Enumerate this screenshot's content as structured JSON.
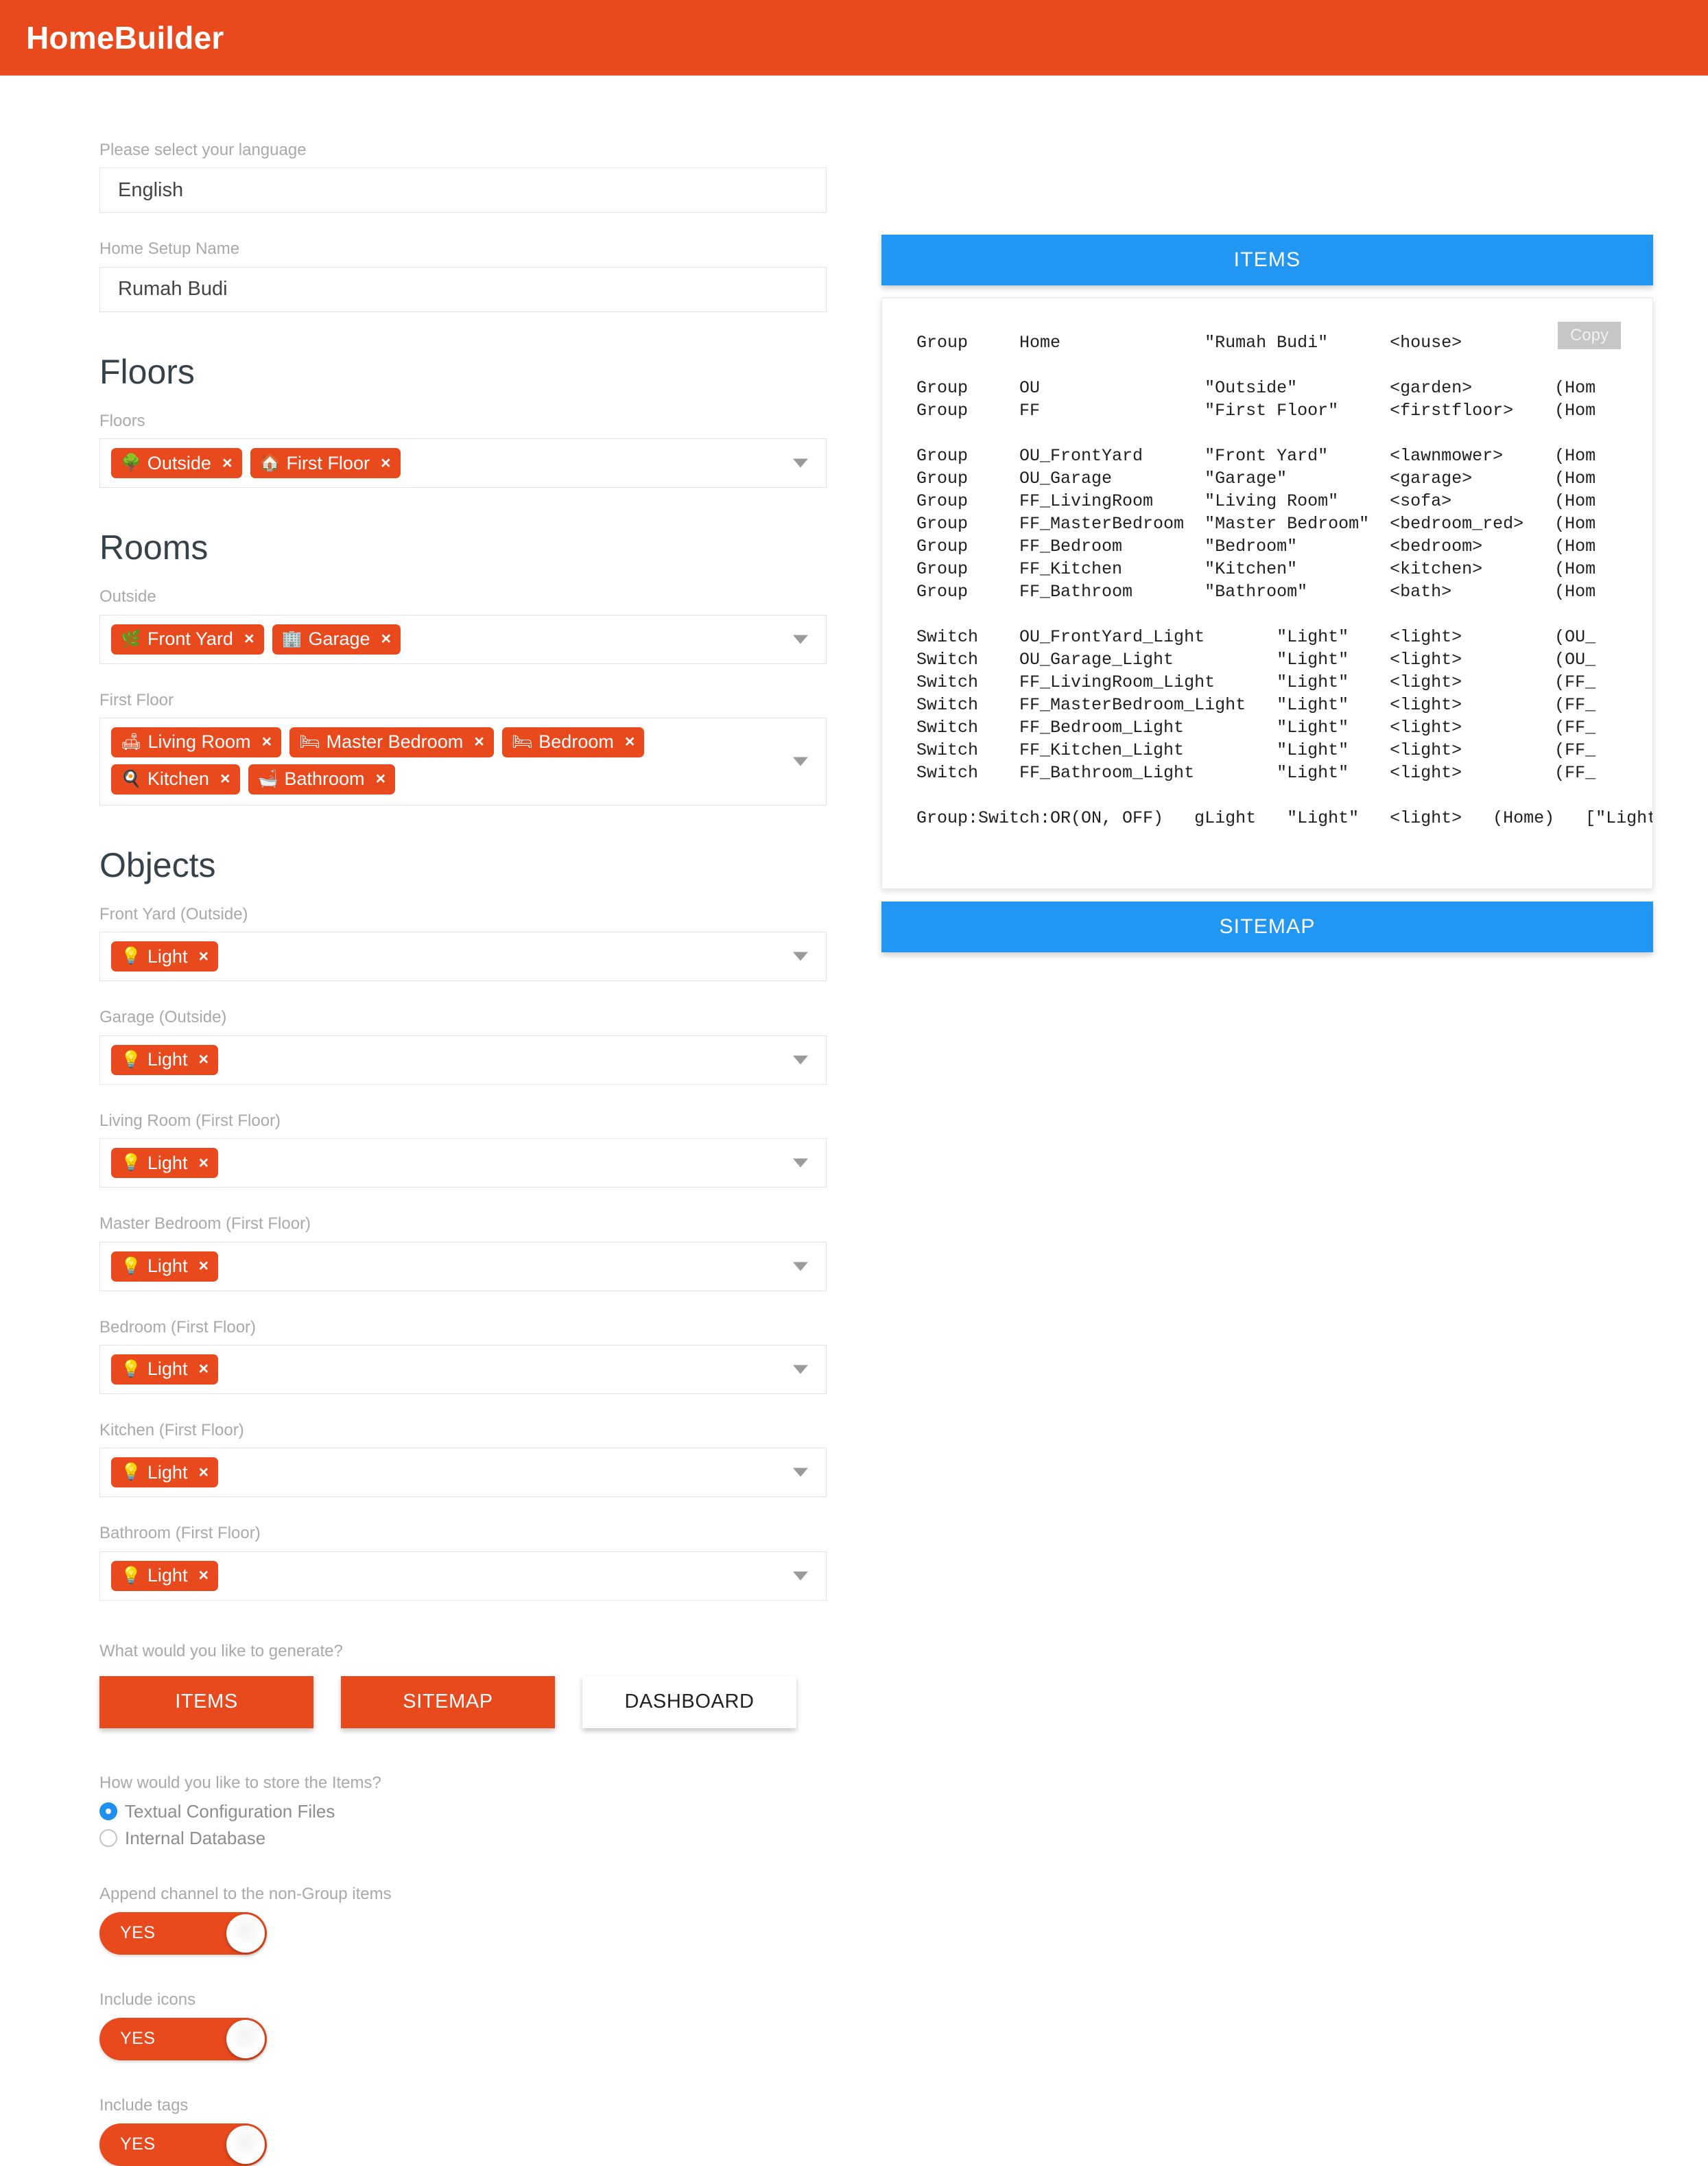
{
  "app": {
    "title": "HomeBuilder",
    "accent_color": "#e8491d",
    "panel_color": "#2196f3",
    "heading_color": "#35424a"
  },
  "form": {
    "language": {
      "label": "Please select your language",
      "value": "English"
    },
    "setup_name": {
      "label": "Home Setup Name",
      "value": "Rumah Budi"
    }
  },
  "floors": {
    "heading": "Floors",
    "field_label": "Floors",
    "chips": [
      {
        "emoji": "🌳",
        "icon_name": "tree-emoji",
        "label": "Outside",
        "remove": "×"
      },
      {
        "emoji": "🏠",
        "icon_name": "house-emoji",
        "label": "First Floor",
        "remove": "×"
      }
    ]
  },
  "rooms": {
    "heading": "Rooms",
    "groups": [
      {
        "label": "Outside",
        "chips": [
          {
            "emoji": "🌿",
            "icon_name": "herb-emoji",
            "label": "Front Yard",
            "remove": "×"
          },
          {
            "emoji": "🏢",
            "icon_name": "building-emoji",
            "label": "Garage",
            "remove": "×"
          }
        ]
      },
      {
        "label": "First Floor",
        "chips": [
          {
            "emoji": "🛋",
            "icon_name": "couch-emoji",
            "label": "Living Room",
            "remove": "×"
          },
          {
            "emoji": "🛏",
            "icon_name": "bed-emoji",
            "label": "Master Bedroom",
            "remove": "×"
          },
          {
            "emoji": "🛏",
            "icon_name": "bed-emoji",
            "label": "Bedroom",
            "remove": "×"
          },
          {
            "emoji": "🍳",
            "icon_name": "stove-emoji",
            "label": "Kitchen",
            "remove": "×"
          },
          {
            "emoji": "🛁",
            "icon_name": "bathtub-emoji",
            "label": "Bathroom",
            "remove": "×"
          }
        ]
      }
    ]
  },
  "objects": {
    "heading": "Objects",
    "groups": [
      {
        "label": "Front Yard (Outside)",
        "chips": [
          {
            "emoji": "💡",
            "icon_name": "bulb-emoji",
            "label": "Light",
            "remove": "×"
          }
        ]
      },
      {
        "label": "Garage (Outside)",
        "chips": [
          {
            "emoji": "💡",
            "icon_name": "bulb-emoji",
            "label": "Light",
            "remove": "×"
          }
        ]
      },
      {
        "label": "Living Room (First Floor)",
        "chips": [
          {
            "emoji": "💡",
            "icon_name": "bulb-emoji",
            "label": "Light",
            "remove": "×"
          }
        ]
      },
      {
        "label": "Master Bedroom (First Floor)",
        "chips": [
          {
            "emoji": "💡",
            "icon_name": "bulb-emoji",
            "label": "Light",
            "remove": "×"
          }
        ]
      },
      {
        "label": "Bedroom (First Floor)",
        "chips": [
          {
            "emoji": "💡",
            "icon_name": "bulb-emoji",
            "label": "Light",
            "remove": "×"
          }
        ]
      },
      {
        "label": "Kitchen (First Floor)",
        "chips": [
          {
            "emoji": "💡",
            "icon_name": "bulb-emoji",
            "label": "Light",
            "remove": "×"
          }
        ]
      },
      {
        "label": "Bathroom (First Floor)",
        "chips": [
          {
            "emoji": "💡",
            "icon_name": "bulb-emoji",
            "label": "Light",
            "remove": "×"
          }
        ]
      }
    ]
  },
  "generate": {
    "label": "What would you like to generate?",
    "buttons": [
      {
        "label": "ITEMS",
        "style": "primary"
      },
      {
        "label": "SITEMAP",
        "style": "primary"
      },
      {
        "label": "DASHBOARD",
        "style": "outline"
      }
    ]
  },
  "storage": {
    "label": "How would you like to store the Items?",
    "options": [
      {
        "label": "Textual Configuration Files",
        "checked": true
      },
      {
        "label": "Internal Database",
        "checked": false
      }
    ]
  },
  "toggles": [
    {
      "label": "Append channel to the non-Group items",
      "value": "YES"
    },
    {
      "label": "Include icons",
      "value": "YES"
    },
    {
      "label": "Include tags",
      "value": "YES"
    }
  ],
  "right_panel": {
    "items_button": "ITEMS",
    "sitemap_button": "SITEMAP",
    "copy_button": "Copy",
    "code": "Group     Home              \"Rumah Budi\"      <house>\n\nGroup     OU                \"Outside\"         <garden>        (Hom\nGroup     FF                \"First Floor\"     <firstfloor>    (Hom\n\nGroup     OU_FrontYard      \"Front Yard\"      <lawnmower>     (Hom\nGroup     OU_Garage         \"Garage\"          <garage>        (Hom\nGroup     FF_LivingRoom     \"Living Room\"     <sofa>          (Hom\nGroup     FF_MasterBedroom  \"Master Bedroom\"  <bedroom_red>   (Hom\nGroup     FF_Bedroom        \"Bedroom\"         <bedroom>       (Hom\nGroup     FF_Kitchen        \"Kitchen\"         <kitchen>       (Hom\nGroup     FF_Bathroom       \"Bathroom\"        <bath>          (Hom\n\nSwitch    OU_FrontYard_Light       \"Light\"    <light>         (OU_\nSwitch    OU_Garage_Light          \"Light\"    <light>         (OU_\nSwitch    FF_LivingRoom_Light      \"Light\"    <light>         (FF_\nSwitch    FF_MasterBedroom_Light   \"Light\"    <light>         (FF_\nSwitch    FF_Bedroom_Light         \"Light\"    <light>         (FF_\nSwitch    FF_Kitchen_Light         \"Light\"    <light>         (FF_\nSwitch    FF_Bathroom_Light        \"Light\"    <light>         (FF_\n\nGroup:Switch:OR(ON, OFF)   gLight   \"Light\"   <light>   (Home)   [\"Light:"
  }
}
